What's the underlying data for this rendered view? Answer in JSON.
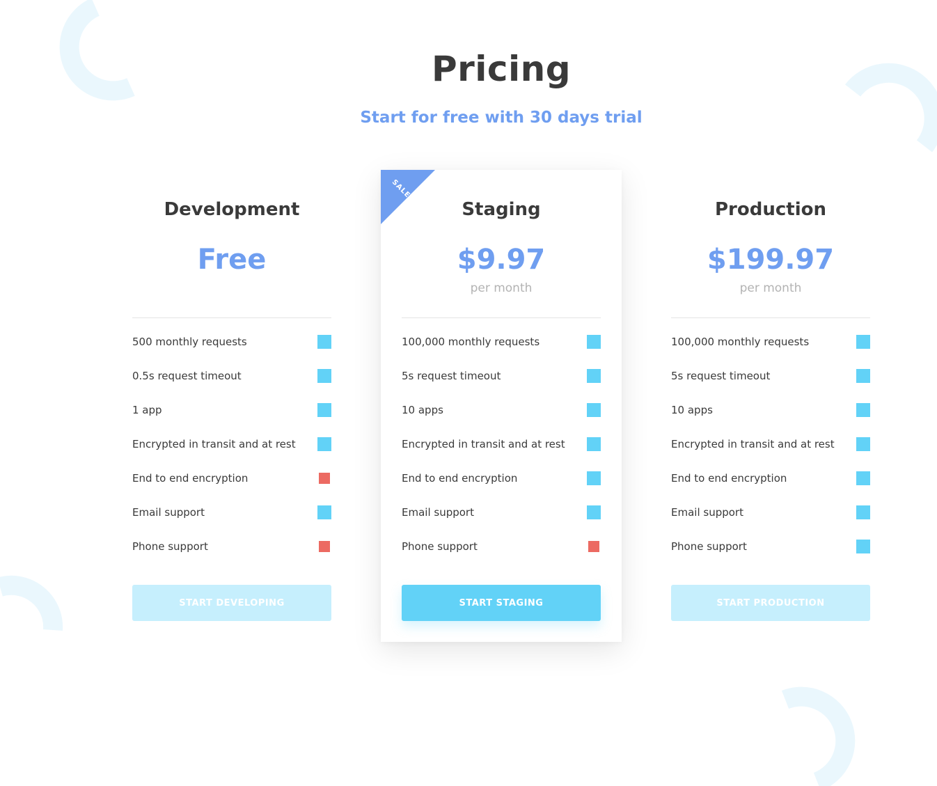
{
  "header": {
    "title": "Pricing",
    "subtitle": "Start for free with 30 days trial"
  },
  "colors": {
    "accent_blue": "#6f9ef0",
    "check_included": "#62d2f7",
    "check_excluded": "#ec6a62",
    "button_primary": "#62d2f7",
    "button_muted": "#c6effd",
    "decoration": "#eaf7fd"
  },
  "plans": [
    {
      "name": "Development",
      "price": "Free",
      "period": "",
      "featured": false,
      "button_label": "START DEVELOPING",
      "features": [
        {
          "label": "500 monthly requests",
          "included": true
        },
        {
          "label": "0.5s request timeout",
          "included": true
        },
        {
          "label": "1 app",
          "included": true
        },
        {
          "label": "Encrypted in transit and at rest",
          "included": true
        },
        {
          "label": "End to end encryption",
          "included": false
        },
        {
          "label": "Email support",
          "included": true
        },
        {
          "label": "Phone support",
          "included": false
        }
      ]
    },
    {
      "name": "Staging",
      "price": "$9.97",
      "period": "per month",
      "featured": true,
      "badge": "SALE",
      "button_label": "START STAGING",
      "features": [
        {
          "label": "100,000 monthly requests",
          "included": true
        },
        {
          "label": "5s request timeout",
          "included": true
        },
        {
          "label": "10 apps",
          "included": true
        },
        {
          "label": "Encrypted in transit and at rest",
          "included": true
        },
        {
          "label": "End to end encryption",
          "included": true
        },
        {
          "label": "Email support",
          "included": true
        },
        {
          "label": "Phone support",
          "included": false
        }
      ]
    },
    {
      "name": "Production",
      "price": "$199.97",
      "period": "per month",
      "featured": false,
      "button_label": "START PRODUCTION",
      "features": [
        {
          "label": "100,000 monthly requests",
          "included": true
        },
        {
          "label": "5s request timeout",
          "included": true
        },
        {
          "label": "10 apps",
          "included": true
        },
        {
          "label": "Encrypted in transit and at rest",
          "included": true
        },
        {
          "label": "End to end encryption",
          "included": true
        },
        {
          "label": "Email support",
          "included": true
        },
        {
          "label": "Phone support",
          "included": true
        }
      ]
    }
  ]
}
